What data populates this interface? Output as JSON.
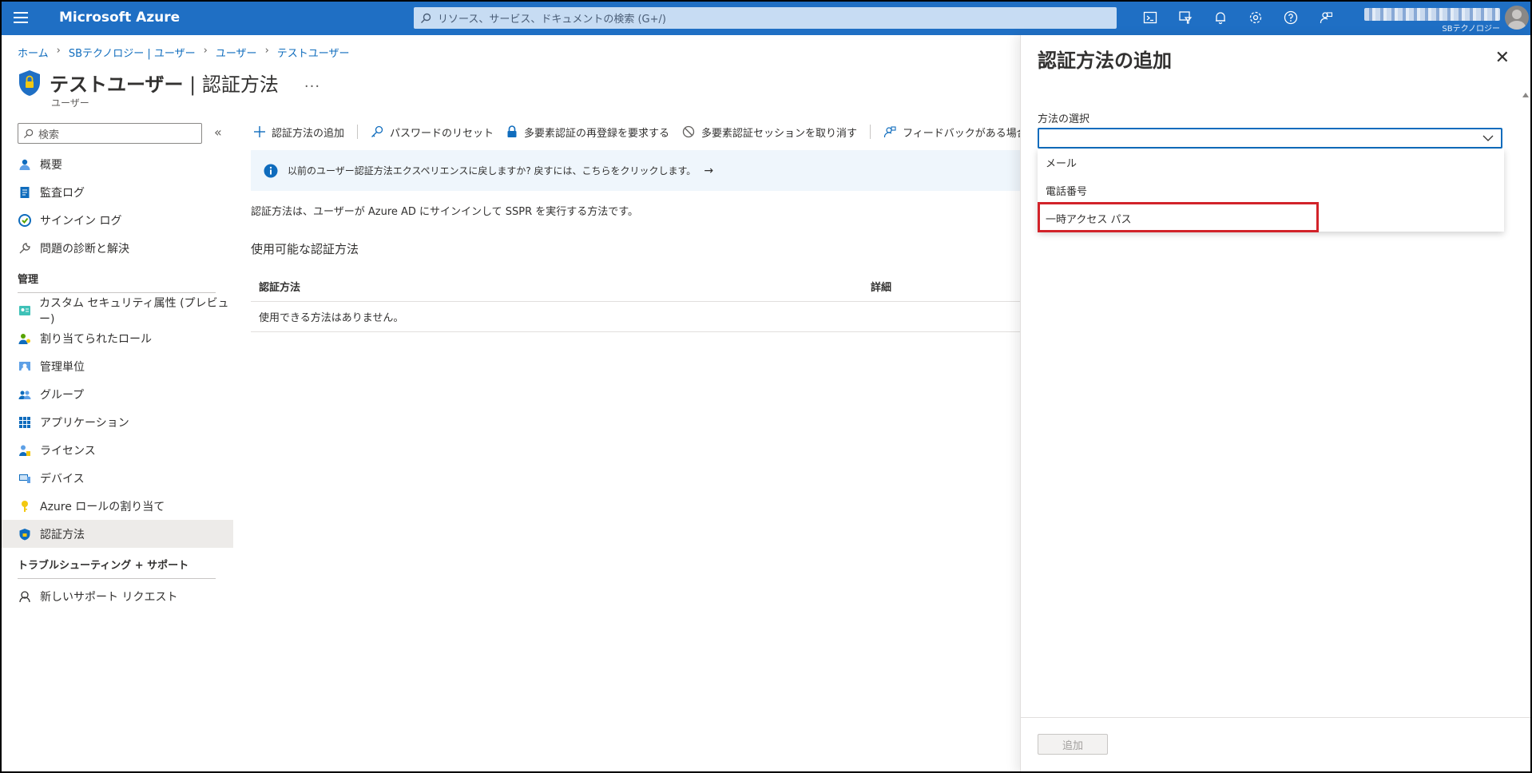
{
  "topbar": {
    "brand": "Microsoft Azure",
    "search_placeholder": "リソース、サービス、ドキュメントの検索 (G+/)",
    "tenant": "SBテクノロジー",
    "icons": [
      "cloud-shell-icon",
      "directory-filter-icon",
      "notifications-icon",
      "settings-icon",
      "help-icon",
      "feedback-icon"
    ]
  },
  "breadcrumb": [
    "ホーム",
    "SBテクノロジー | ユーザー",
    "ユーザー",
    "テストユーザー"
  ],
  "page": {
    "title_bold": "テストユーザー",
    "title_rest": " | 認証方法",
    "subtitle": "ユーザー",
    "more": "..."
  },
  "sidebar": {
    "search_placeholder": "検索",
    "collapse": "«",
    "items_top": [
      {
        "label": "概要",
        "icon": "overview-icon"
      },
      {
        "label": "監査ログ",
        "icon": "audit-log-icon"
      },
      {
        "label": "サインイン ログ",
        "icon": "signin-log-icon"
      },
      {
        "label": "問題の診断と解決",
        "icon": "wrench-icon"
      }
    ],
    "section_manage": "管理",
    "items_manage": [
      {
        "label": "カスタム セキュリティ属性 (プレビュー)",
        "icon": "custom-attribute-icon"
      },
      {
        "label": "割り当てられたロール",
        "icon": "assigned-roles-icon"
      },
      {
        "label": "管理単位",
        "icon": "admin-unit-icon"
      },
      {
        "label": "グループ",
        "icon": "groups-icon"
      },
      {
        "label": "アプリケーション",
        "icon": "applications-icon"
      },
      {
        "label": "ライセンス",
        "icon": "licenses-icon"
      },
      {
        "label": "デバイス",
        "icon": "devices-icon"
      },
      {
        "label": "Azure ロールの割り当て",
        "icon": "key-icon"
      },
      {
        "label": "認証方法",
        "icon": "shield-icon"
      }
    ],
    "section_support": "トラブルシューティング + サポート",
    "items_support": [
      {
        "label": "新しいサポート リクエスト",
        "icon": "support-icon"
      }
    ]
  },
  "commands": {
    "add": "認証方法の追加",
    "reset_password": "パスワードのリセット",
    "require_mfa": "多要素認証の再登録を要求する",
    "revoke_mfa": "多要素認証セッションを取り消す",
    "feedback": "フィードバックがある場合"
  },
  "info": {
    "text": "以前のユーザー認証方法エクスペリエンスに戻しますか? 戻すには、こちらをクリックします。",
    "arrow": "→"
  },
  "main": {
    "description": "認証方法は、ユーザーが Azure AD にサインインして SSPR を実行する方法です。",
    "section_title": "使用可能な認証方法",
    "table": {
      "headers": [
        "認証方法",
        "詳細"
      ],
      "empty": "使用できる方法はありません。"
    }
  },
  "blade": {
    "title": "認証方法の追加",
    "close": "✕",
    "label": "方法の選択",
    "selected_value": "",
    "options": [
      "メール",
      "電話番号",
      "一時アクセス パス"
    ],
    "add_button": "追加"
  },
  "colors": {
    "topbar": "#1f6fc4",
    "accent": "#0f6cbd",
    "highlight": "#d2232a"
  }
}
